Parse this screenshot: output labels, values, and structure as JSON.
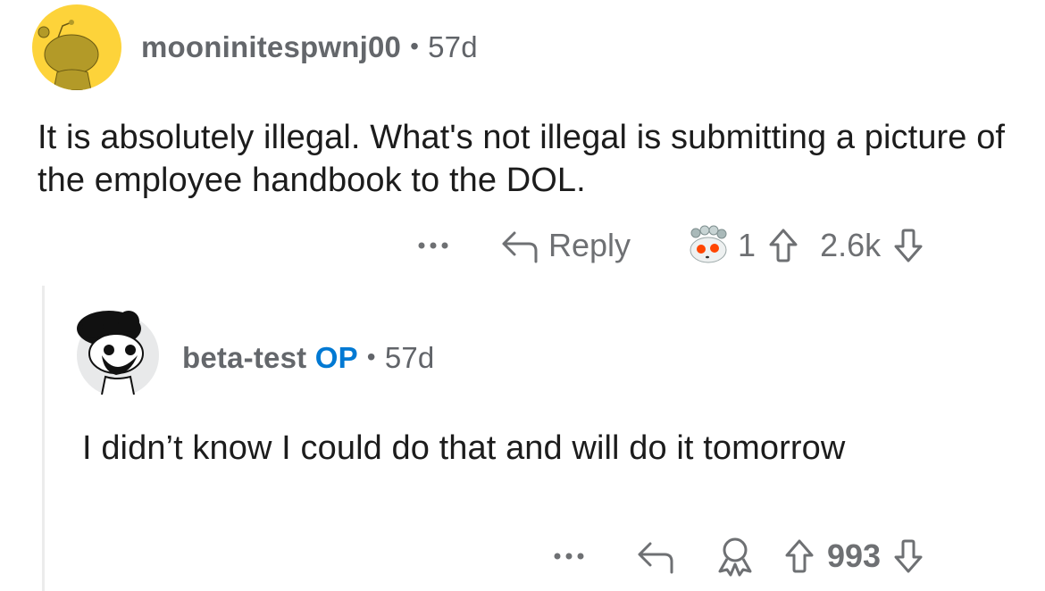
{
  "comments": [
    {
      "username": "mooninitespwnj00",
      "separator": "•",
      "age": "57d",
      "avatar": "snoo-yellow-avatar",
      "body": "It is absolutely illegal. What's not illegal is submitting a picture of the employee handbook to the DOL.",
      "actions": {
        "more_icon": "more-dots-icon",
        "reply_label": "Reply",
        "award_icon": "snoo-award-icon",
        "award_count": "1",
        "score": "2.6k"
      }
    },
    {
      "username": "beta-test",
      "op_badge": "OP",
      "separator": "•",
      "age": "57d",
      "avatar": "snoo-afro-avatar",
      "body": "I didn’t know I could do that and will do it tomorrow",
      "actions": {
        "more_icon": "more-dots-icon",
        "award_icon": "award-ribbon-icon",
        "score": "993"
      }
    }
  ],
  "colors": {
    "op_accent": "#0079d3",
    "avatar_yellow": "#fdd33a",
    "meta_gray": "#616469"
  }
}
